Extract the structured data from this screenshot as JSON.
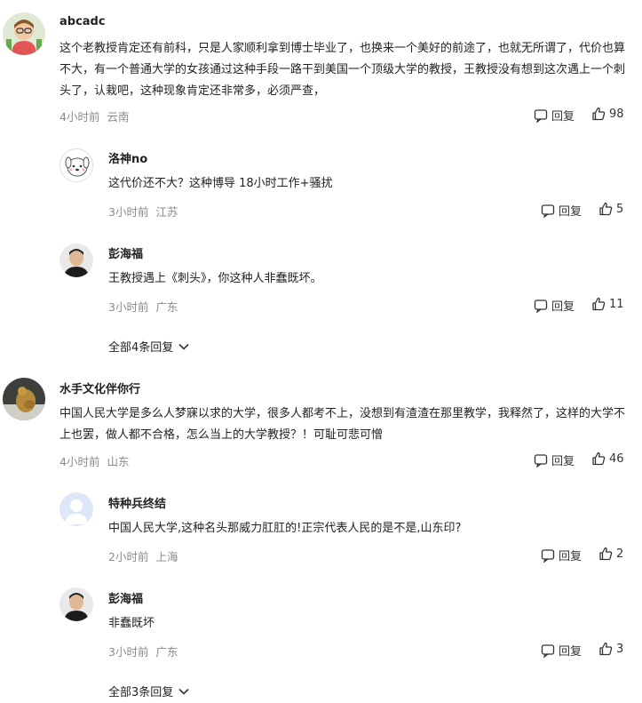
{
  "reply_label": "回复",
  "threads": [
    {
      "user": "abcadc",
      "text": "这个老教授肯定还有前科，只是人家顺利拿到博士毕业了，也换来一个美好的前途了，也就无所谓了，代价也算不大，有一个普通大学的女孩通过这种手段一路干到美国一个顶级大学的教授，王教授没有想到这次遇上一个刺头了，认栽吧，这种现象肯定还非常多，必须严查，",
      "time": "4小时前",
      "location": "云南",
      "likes": "98",
      "replies": [
        {
          "user": "洛神no",
          "text": "这代价还不大？这种博导 18小时工作+骚扰",
          "time": "3小时前",
          "location": "江苏",
          "likes": "5"
        },
        {
          "user": "彭海福",
          "text": "王教授遇上《刺头》，你这种人非蠢既坏。",
          "time": "3小时前",
          "location": "广东",
          "likes": "11"
        }
      ],
      "expand_label": "全部4条回复"
    },
    {
      "user": "水手文化伴你行",
      "text": "中国人民大学是多么人梦寐以求的大学，很多人都考不上，没想到有渣渣在那里教学，我释然了，这样的大学不上也罢，做人都不合格，怎么当上的大学教授？！可耻可悲可憎",
      "time": "4小时前",
      "location": "山东",
      "likes": "46",
      "replies": [
        {
          "user": "特种兵终结",
          "text": "中国人民大学,这种名头那威力肛肛的!正宗代表人民的是不是,山东印?",
          "time": "2小时前",
          "location": "上海",
          "likes": "2"
        },
        {
          "user": "彭海福",
          "text": "非蠢既坏",
          "time": "3小时前",
          "location": "广东",
          "likes": "3"
        }
      ],
      "expand_label": "全部3条回复"
    }
  ]
}
